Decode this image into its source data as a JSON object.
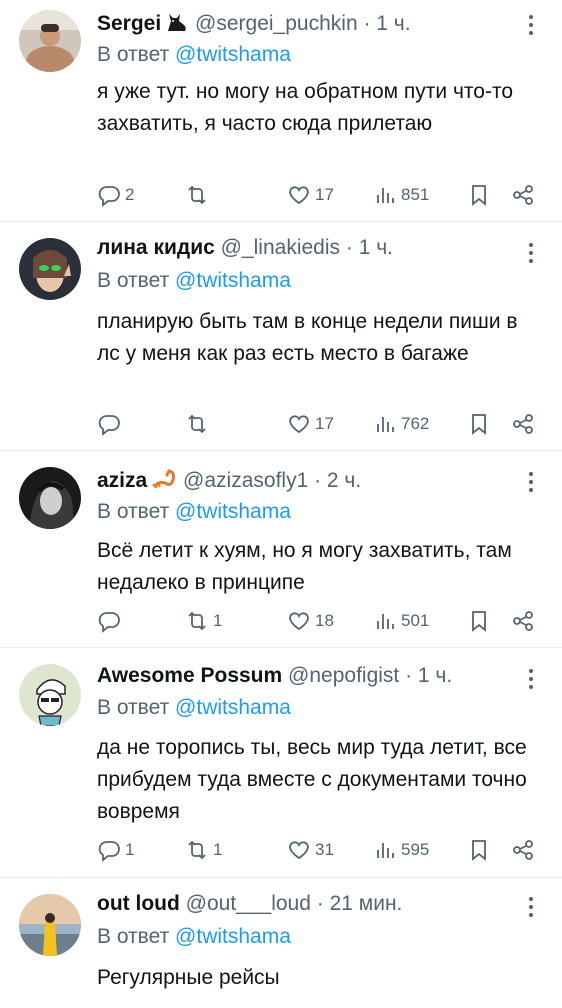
{
  "replies": [
    {
      "name": "Sergei",
      "handle": "@sergei_puchkin",
      "time": "· 1 ч.",
      "reply_prefix": "В ответ",
      "reply_to": "@twitshama",
      "text": "я уже тут. но могу на обратном пути что-то захватить, я часто сюда прилетаю",
      "replies_count": "2",
      "retweets_count": "",
      "likes_count": "17",
      "views_count": "851"
    },
    {
      "name": "лина кидис",
      "handle": "@_linakiedis",
      "time": "· 1 ч.",
      "reply_prefix": "В ответ",
      "reply_to": "@twitshama",
      "text": "планирую быть там в конце недели пиши в лс у меня как раз есть место в багаже",
      "replies_count": "",
      "retweets_count": "",
      "likes_count": "17",
      "views_count": "762"
    },
    {
      "name": "aziza",
      "handle": "@azizasofly1",
      "time": "· 2 ч.",
      "reply_prefix": "В ответ",
      "reply_to": "@twitshama",
      "text": "Всё летит к хуям, но я могу захватить, там недалеко в принципе",
      "replies_count": "",
      "retweets_count": "1",
      "likes_count": "18",
      "views_count": "501"
    },
    {
      "name": "Awesome Possum",
      "handle": "@nepofigist",
      "time": "· 1 ч.",
      "reply_prefix": "В ответ",
      "reply_to": "@twitshama",
      "text": "да не торопись ты, весь мир туда летит, все прибудем туда вместе с документами точно вовремя",
      "replies_count": "1",
      "retweets_count": "1",
      "likes_count": "31",
      "views_count": "595"
    },
    {
      "name": "out loud",
      "handle": "@out___loud",
      "time": "· 21 мин.",
      "reply_prefix": "В ответ",
      "reply_to": "@twitshama",
      "text": "Регулярные рейсы"
    }
  ],
  "colors": {
    "link": "#1d9bf0",
    "muted": "#536471",
    "text": "#0f1419",
    "divider": "#e6ecf0"
  },
  "icons": {
    "reply": "reply-icon",
    "retweet": "retweet-icon",
    "like": "heart-icon",
    "views": "views-icon",
    "bookmark": "bookmark-icon",
    "share": "share-icon",
    "more": "more-icon"
  }
}
